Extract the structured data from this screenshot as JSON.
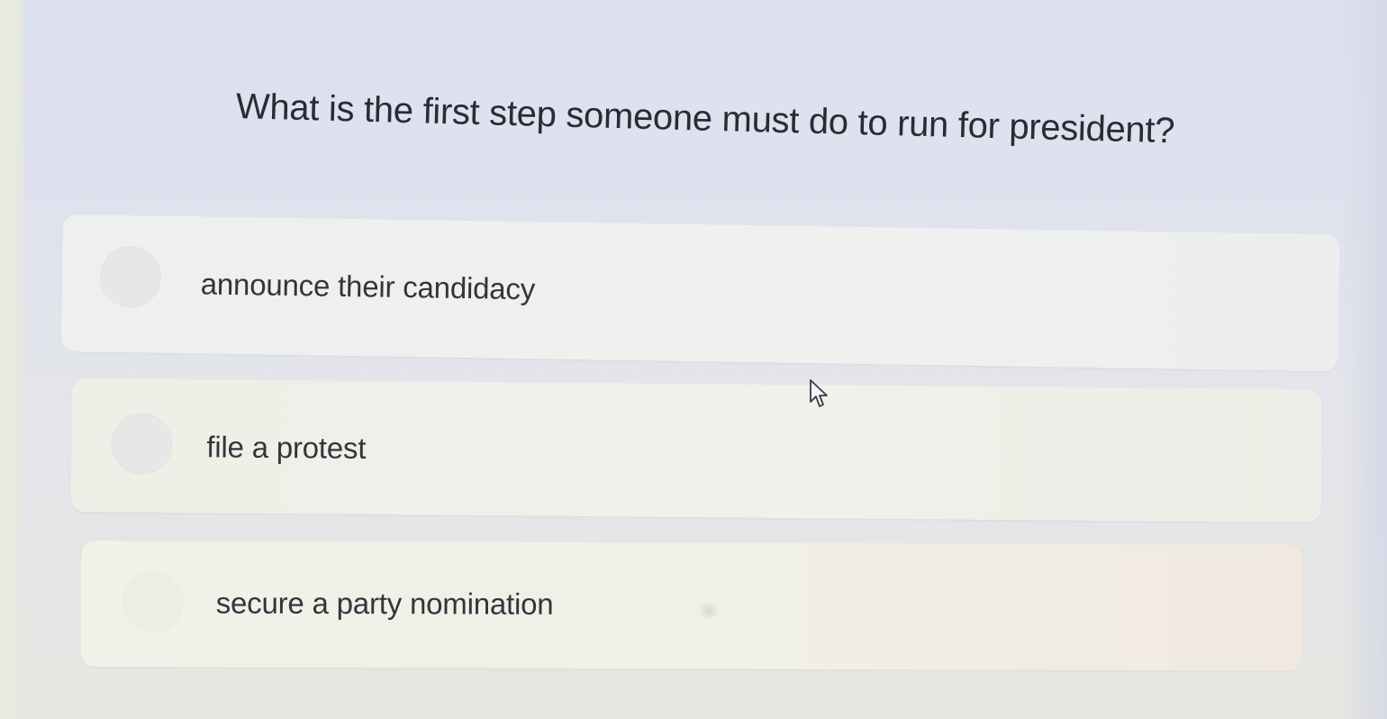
{
  "question": {
    "text": "What is the first step someone must do to run for president?"
  },
  "options": [
    {
      "label": "announce their candidacy",
      "selected": false
    },
    {
      "label": "file a protest",
      "selected": false
    },
    {
      "label": "secure a party nomination",
      "selected": false
    }
  ],
  "cursor": {
    "icon": "arrow-cursor-icon"
  },
  "colors": {
    "background": "#dfe2ee",
    "option_background": "#eef0ec",
    "text": "#2b2b33"
  }
}
